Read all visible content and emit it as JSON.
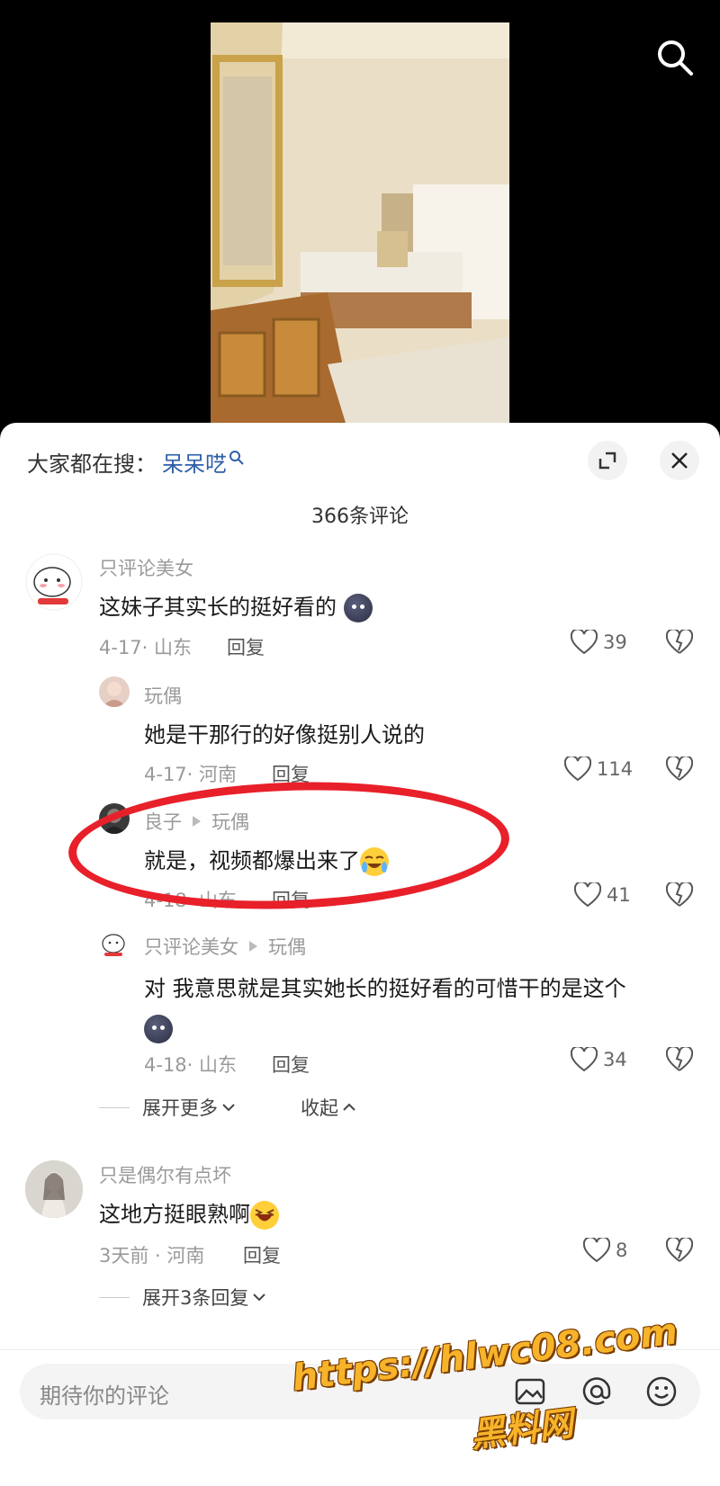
{
  "hot_search": {
    "prefix": "大家都在搜：",
    "term": "呆呆呓"
  },
  "comment_count": "366条评论",
  "comments": [
    {
      "user": "只评论美女",
      "text": "这妹子其实长的挺好看的",
      "date": "4-17",
      "location": "山东",
      "reply": "回复",
      "likes": "39"
    },
    {
      "user": "玩偶",
      "text": "她是干那行的好像挺别人说的",
      "date": "4-17",
      "location": "河南",
      "reply": "回复",
      "likes": "114"
    },
    {
      "user": "良子",
      "reply_to": "玩偶",
      "text": "就是，视频都爆出来了",
      "date": "4-18",
      "location": "山东",
      "reply": "回复",
      "likes": "41"
    },
    {
      "user": "只评论美女",
      "reply_to": "玩偶",
      "text": "对 我意思就是其实她长的挺好看的可惜干的是这个",
      "date": "4-18",
      "location": "山东",
      "reply": "回复",
      "likes": "34"
    },
    {
      "user": "只是偶尔有点坏",
      "text": "这地方挺眼熟啊",
      "date": "3天前",
      "location": "河南",
      "reply": "回复",
      "likes": "8"
    }
  ],
  "expanders": {
    "more": "展开更多",
    "collapse": "收起",
    "expand_three": "展开3条回复"
  },
  "input": {
    "placeholder": "期待你的评论"
  },
  "watermark": {
    "url": "https://hlwc08.com",
    "label": "黑料网"
  },
  "colors": {
    "accent_blue": "#2d5ea8",
    "highlight_red": "#e8202a"
  }
}
